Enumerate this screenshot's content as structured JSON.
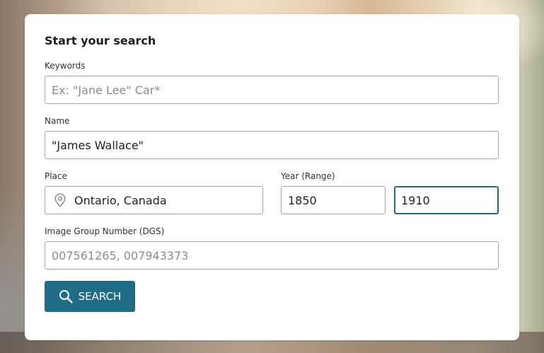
{
  "form": {
    "title": "Start your search",
    "keywords": {
      "label": "Keywords",
      "placeholder": "Ex: \"Jane Lee\" Car*",
      "value": ""
    },
    "name": {
      "label": "Name",
      "placeholder": "",
      "value": "\"James Wallace\""
    },
    "place": {
      "label": "Place",
      "value": "Ontario, Canada",
      "icon": "map-pin-icon"
    },
    "year_range": {
      "label": "Year (Range)",
      "from": "1850",
      "to": "1910"
    },
    "dgs": {
      "label": "Image Group Number (DGS)",
      "placeholder": "007561265, 007943373",
      "value": ""
    },
    "search_button": {
      "label": "SEARCH",
      "icon": "search-icon"
    }
  },
  "colors": {
    "accent": "#1f6c86",
    "field_border": "#a4a4a4",
    "card_background": "#ffffff"
  }
}
